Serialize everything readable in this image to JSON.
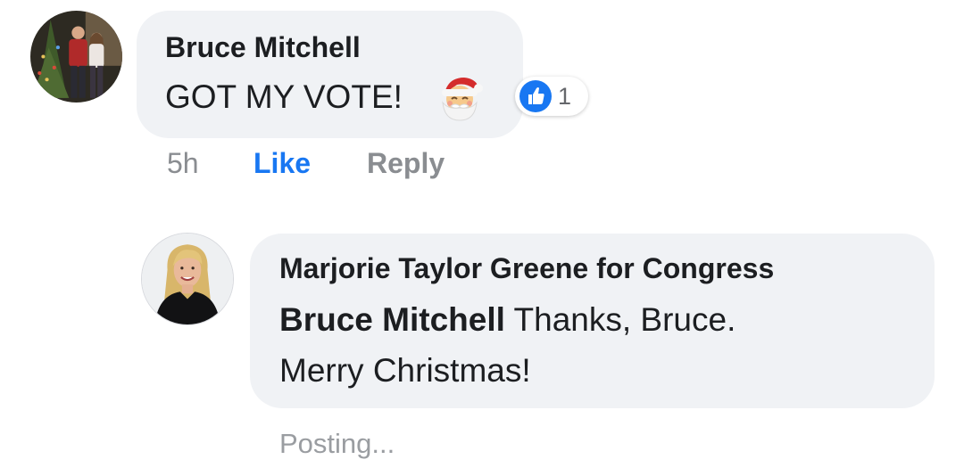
{
  "comment": {
    "author": "Bruce Mitchell",
    "text": "GOT MY VOTE!",
    "emoji": "santa-claus-emoji",
    "reaction_count": "1",
    "reaction_icon": "like-icon",
    "timestamp": "5h",
    "like_label": "Like",
    "reply_label": "Reply"
  },
  "reply": {
    "author": "Marjorie Taylor Greene for Congress",
    "mention": "Bruce Mitchell",
    "text_after_mention": " Thanks, Bruce.",
    "text_line2": "Merry Christmas!",
    "status": "Posting..."
  },
  "colors": {
    "bubble_bg": "#f0f2f5",
    "like_blue": "#1877f2",
    "secondary_text": "#8a8d91",
    "primary_text": "#1c1e21"
  }
}
